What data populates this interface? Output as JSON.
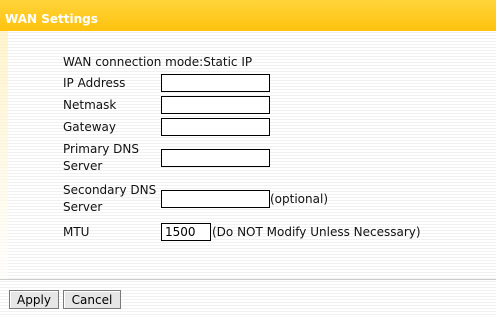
{
  "header": {
    "title": "WAN Settings"
  },
  "connection_mode": {
    "label": "WAN connection mode:",
    "value": "Static IP"
  },
  "fields": {
    "ip_address": {
      "label": "IP Address",
      "value": ""
    },
    "netmask": {
      "label": "Netmask",
      "value": ""
    },
    "gateway": {
      "label": "Gateway",
      "value": ""
    },
    "primary_dns": {
      "label": "Primary DNS Server",
      "value": ""
    },
    "secondary_dns": {
      "label": "Secondary DNS Server",
      "value": "",
      "hint": "(optional)"
    },
    "mtu": {
      "label": "MTU",
      "value": "1500",
      "hint": "(Do NOT Modify Unless Necessary)"
    }
  },
  "actions": {
    "apply_label": "Apply",
    "cancel_label": "Cancel"
  }
}
